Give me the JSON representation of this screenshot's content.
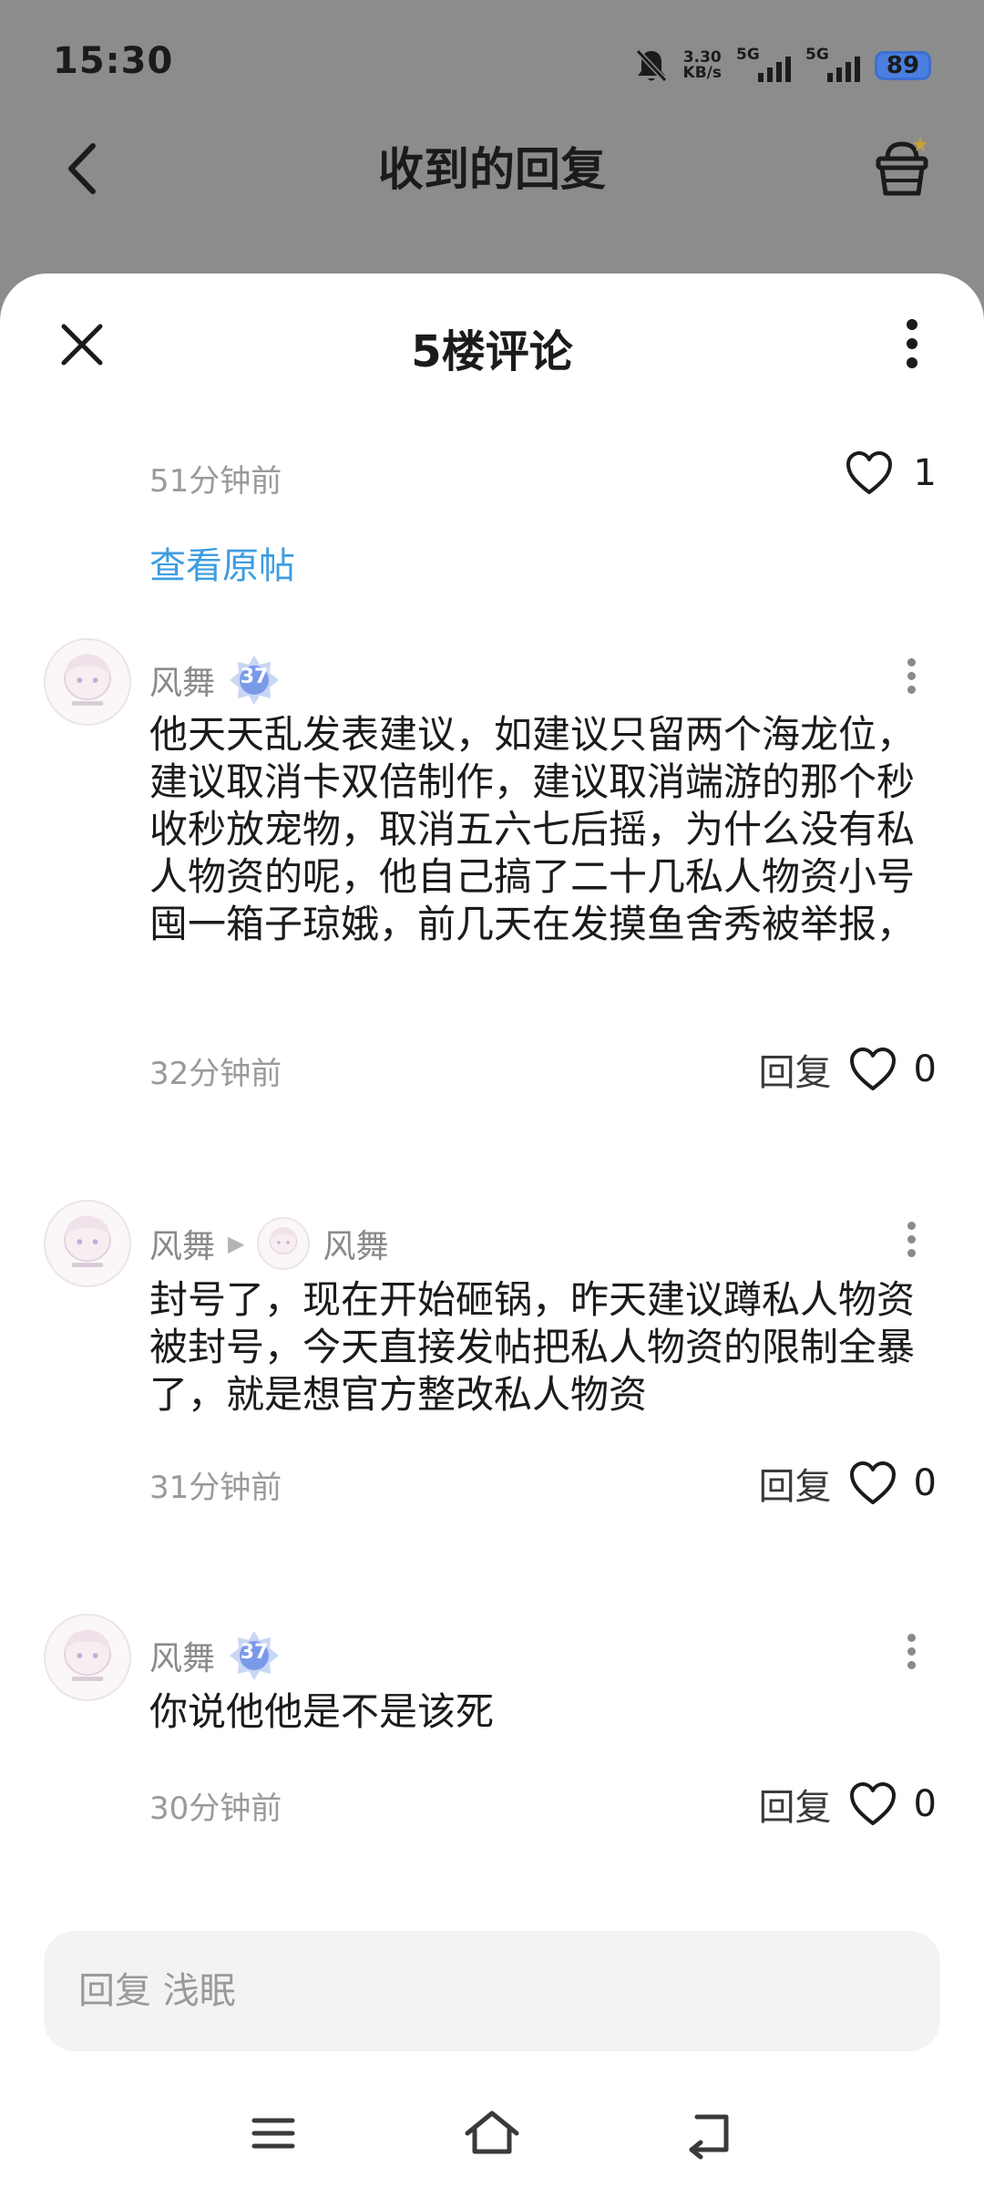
{
  "status_bar": {
    "time": "15:30",
    "net_speed_value": "3.30",
    "net_speed_unit": "KB/s",
    "signal_1_label": "5G",
    "signal_2_label": "5G",
    "battery": "89"
  },
  "header": {
    "title": "收到的回复",
    "back_icon": "chevron-left-icon",
    "cart_icon": "basket-icon"
  },
  "sheet": {
    "title": "5楼评论",
    "close_icon": "close-icon",
    "more_icon": "more-vertical-icon",
    "post_time": "51分钟前",
    "post_likes": "1",
    "view_original_label": "查看原帖"
  },
  "comments": [
    {
      "author": "风舞",
      "level": "37",
      "text": "他天天乱发表建议，如建议只留两个海龙位，建议取消卡双倍制作，建议取消端游的那个秒收秒放宠物，取消五六七后摇，为什么没有私人物资的呢，他自己搞了二十几私人物资小号囤一箱子琼娥，前几天在发摸鱼舍秀被举报，",
      "time": "32分钟前",
      "reply_label": "回复",
      "likes": "0"
    },
    {
      "author": "风舞",
      "reply_to": "风舞",
      "text": "封号了，现在开始砸锅，昨天建议蹲私人物资被封号，今天直接发帖把私人物资的限制全暴了，就是想官方整改私人物资",
      "time": "31分钟前",
      "reply_label": "回复",
      "likes": "0"
    },
    {
      "author": "风舞",
      "level": "37",
      "text": "你说他他是不是该死",
      "time": "30分钟前",
      "reply_label": "回复",
      "likes": "0"
    }
  ],
  "reply_input": {
    "placeholder": "回复 浅眠"
  },
  "nav_bar": {
    "menu_icon": "menu-icon",
    "home_icon": "home-icon",
    "back_icon": "back-icon"
  },
  "colors": {
    "overlay": "#8c8c8c",
    "link": "#3d9de0",
    "level_badge": "#7a9ae8",
    "text_primary": "#1b1b1b",
    "text_secondary": "#9a9a9a"
  }
}
